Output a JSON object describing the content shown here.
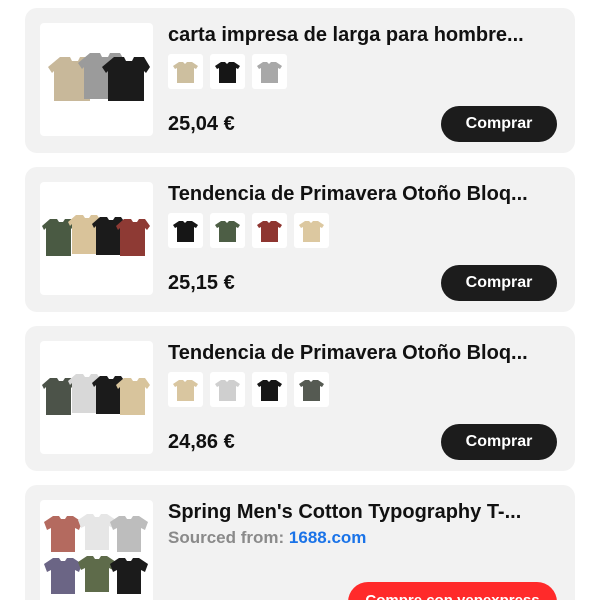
{
  "products": [
    {
      "title": "carta impresa de larga para hombre...",
      "price": "25,04 €",
      "button_label": "Comprar",
      "thumbnail_colors": [
        "#c8b89a",
        "#9b9b9b",
        "#1b1b1b"
      ],
      "swatch_colors": [
        "#cdbf9f",
        "#161616",
        "#a8a8a8"
      ]
    },
    {
      "title": "Tendencia de Primavera Otoño Bloq...",
      "price": "25,15 €",
      "button_label": "Comprar",
      "thumbnail_colors": [
        "#4a5a43",
        "#d9c39a",
        "#1b1b1b",
        "#8e3a34"
      ],
      "swatch_colors": [
        "#161616",
        "#4d5e45",
        "#8e3530",
        "#dcc8a0"
      ]
    },
    {
      "title": "Tendencia de Primavera Otoño Bloq...",
      "price": "24,86 €",
      "button_label": "Comprar",
      "thumbnail_colors": [
        "#4c5349",
        "#d8d8d8",
        "#1b1b1b",
        "#d8c49c"
      ],
      "swatch_colors": [
        "#d9c6a0",
        "#cfcfcf",
        "#161616",
        "#555a52"
      ]
    },
    {
      "title": "Spring Men's Cotton Typography T-...",
      "sourced_label": "Sourced from:",
      "sourced_site": "1688.com",
      "button_label": "Compre con yepexpress",
      "thumbnail_colors": [
        "#b46a5f",
        "#e6e6e6",
        "#bdbdbd",
        "#6b6585",
        "#5e6b4a",
        "#1b1b1b"
      ]
    }
  ],
  "colors": {
    "card_bg": "#f2f2f2",
    "button_dark": "#1c1c1c",
    "button_red": "#ff2a2a",
    "link_blue": "#1a73e8"
  }
}
